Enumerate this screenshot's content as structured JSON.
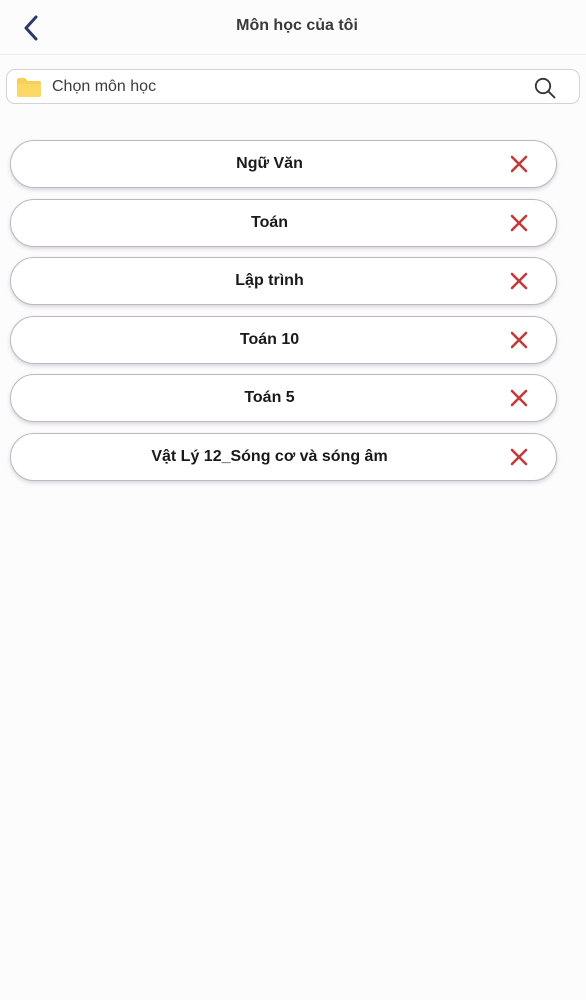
{
  "header": {
    "title": "Môn học của tôi"
  },
  "search": {
    "placeholder": "Chọn môn học"
  },
  "subjects": [
    {
      "name": "Ngữ Văn"
    },
    {
      "name": "Toán"
    },
    {
      "name": "Lập trình"
    },
    {
      "name": "Toán 10"
    },
    {
      "name": "Toán 5"
    },
    {
      "name": "Vật Lý 12_Sóng cơ và sóng âm"
    }
  ],
  "colors": {
    "back_icon": "#2b3a66",
    "folder_icon": "#f8cf58",
    "remove_icon": "#c33a3a",
    "border": "#bdb8c1"
  },
  "icons": {
    "back": "chevron-left-icon",
    "folder": "folder-icon",
    "search": "search-icon",
    "remove": "close-icon"
  }
}
